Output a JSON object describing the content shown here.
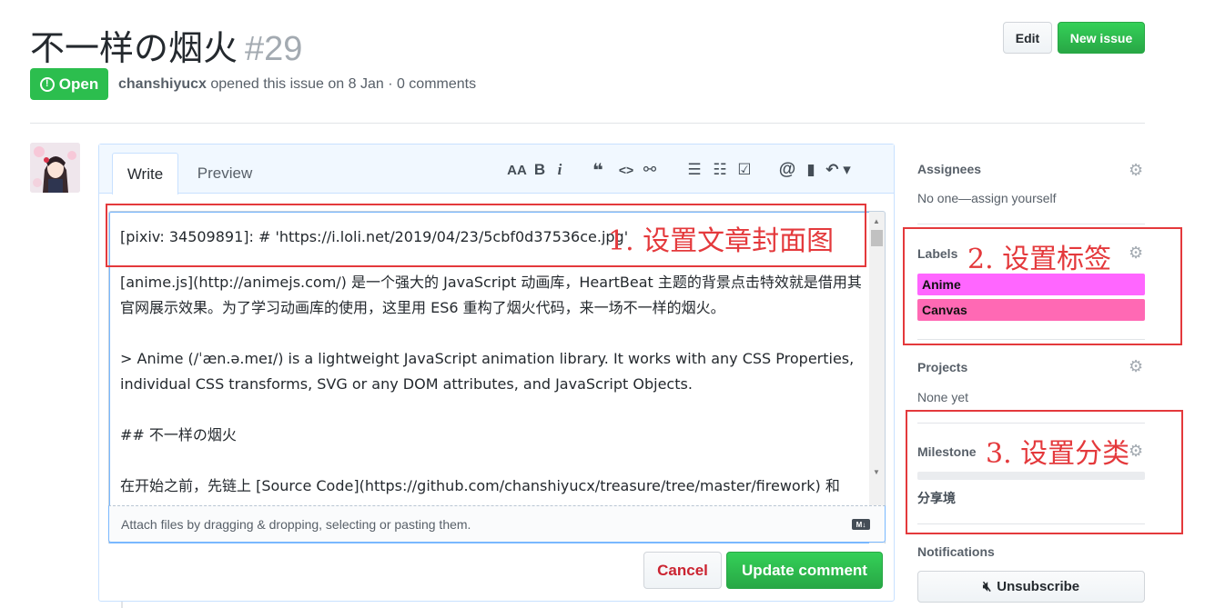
{
  "issue": {
    "title": "不一样の烟火",
    "number": "#29",
    "state_label": "Open",
    "state_icon": "!",
    "author": "chanshiyucx",
    "meta_rest": " opened this issue on 8 Jan · 0 comments"
  },
  "header_buttons": {
    "edit": "Edit",
    "new_issue": "New issue"
  },
  "editor": {
    "tab_write": "Write",
    "tab_preview": "Preview",
    "toolbar": {
      "text_size": "AA",
      "bold": "B",
      "italic": "i",
      "quote": "❝",
      "code": "<>",
      "link": "⚯",
      "bullet_list": "☰",
      "numbered_list": "☷",
      "task_list": "☑",
      "mention": "@",
      "reference": "▮",
      "reply": "↶ ▾"
    },
    "lines": [
      "[pixiv: 34509891]: # 'https://i.loli.net/2019/04/23/5cbf0d37536ce.jpg'",
      "[anime.js](http://animejs.com/) 是一个强大的 JavaScript 动画库，HeartBeat 主题的背景点击特效就是借用其官网展示效果。为了学习动画库的使用，这里用 ES6 重构了烟火代码，来一场不一样的烟火。",
      "> Anime (/ˈæn.ə.meɪ/) is a lightweight JavaScript animation library. It works with any CSS Properties, individual CSS transforms, SVG or any DOM attributes, and JavaScript Objects.",
      "## 不一样の烟火",
      "在开始之前，先链上 [Source Code](https://github.com/chanshiyucx/treasure/tree/master/firework) 和"
    ],
    "attach_hint": "Attach files by dragging & dropping, selecting or pasting them.",
    "markdown_badge": "M↓",
    "cancel": "Cancel",
    "update": "Update comment"
  },
  "annotations": {
    "cover": "1. 设置文章封面图",
    "labels": "2. 设置标签",
    "category": "3. 设置分类",
    "color": "#e4393c"
  },
  "sidebar": {
    "assignees": {
      "heading": "Assignees",
      "value": "No one—assign yourself"
    },
    "labels": {
      "heading": "Labels",
      "items": [
        {
          "name": "Anime",
          "color": "#ff66ff"
        },
        {
          "name": "Canvas",
          "color": "#ff69b4"
        }
      ]
    },
    "projects": {
      "heading": "Projects",
      "value": "None yet"
    },
    "milestone": {
      "heading": "Milestone",
      "name": "分享境",
      "progress": 0
    },
    "notifications": {
      "heading": "Notifications",
      "unsubscribe": "Unsubscribe"
    }
  },
  "colors": {
    "green": "#2cbe4e",
    "accent_blue": "#c8e1ff",
    "danger": "#cb2431"
  }
}
